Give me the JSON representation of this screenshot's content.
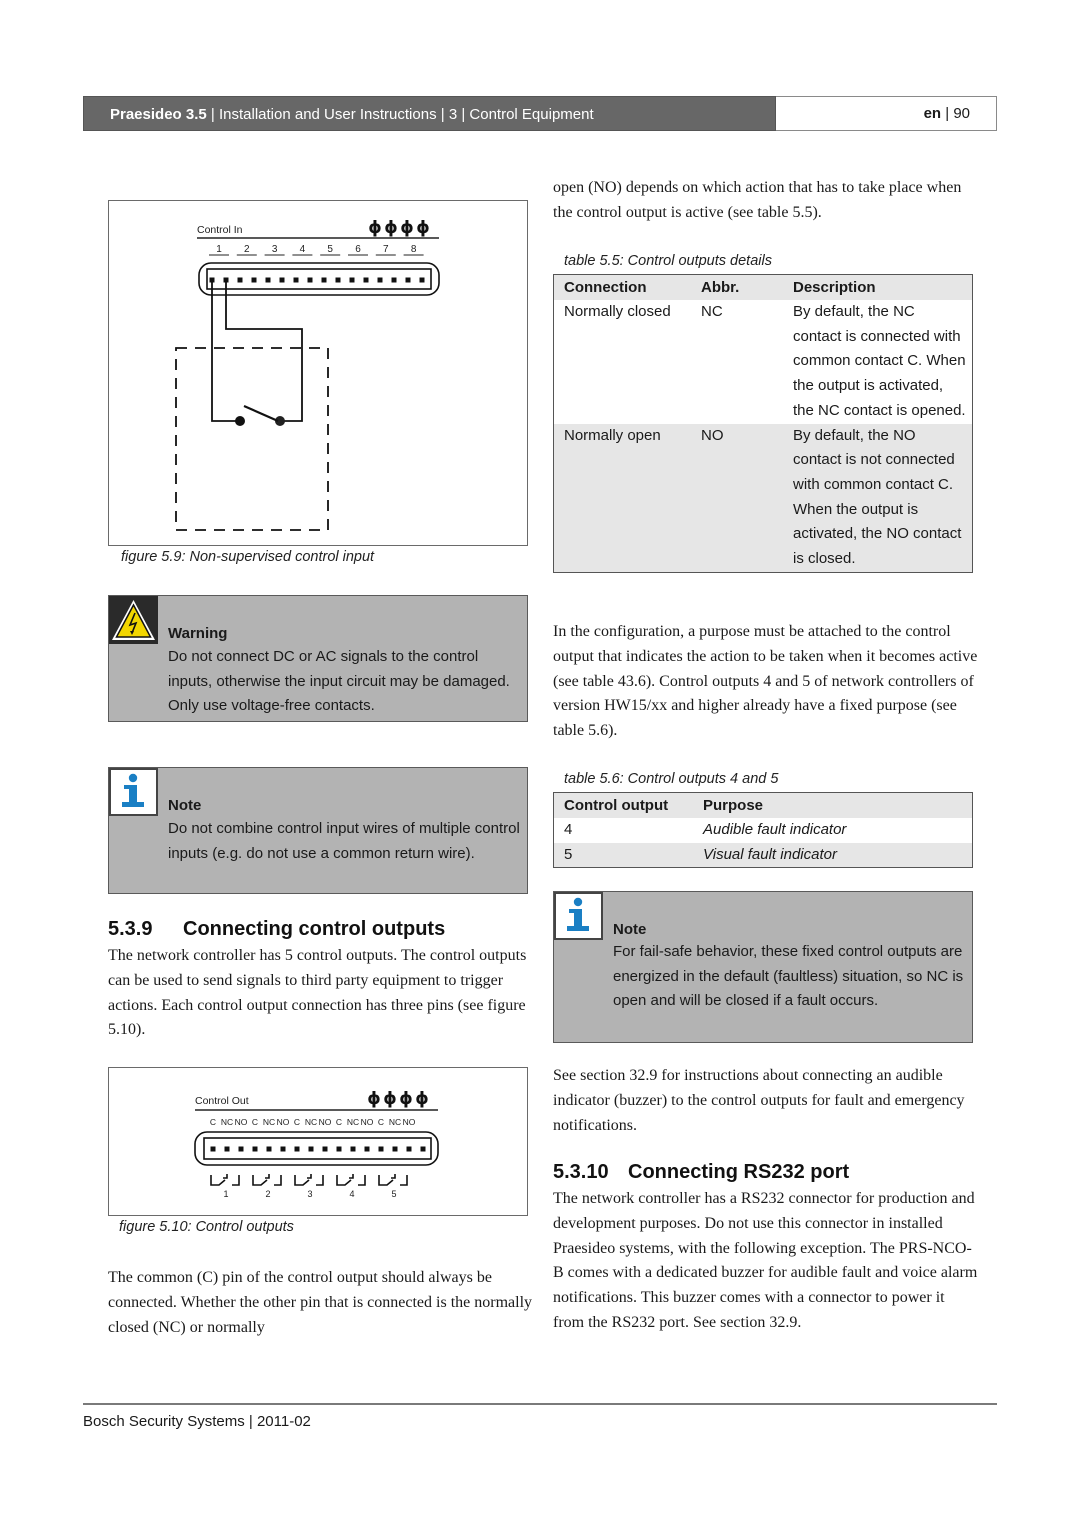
{
  "header": {
    "product": "Praesideo 3.5",
    "sep1": " | ",
    "doc_title": "Installation and User Instructions",
    "sep2": " | ",
    "chapter_num": "3",
    "sep3": " | ",
    "chapter_title": "Control Equipment",
    "lang": "en",
    "sep4": " | ",
    "page": "90"
  },
  "figure_5_9": {
    "label": "Control In",
    "pin_numbers": [
      "1",
      "2",
      "3",
      "4",
      "5",
      "6",
      "7",
      "8"
    ],
    "ground_symbols": [
      "ϕ",
      "ϕ",
      "ϕ",
      "ϕ"
    ],
    "caption": "figure 5.9: Non-supervised control input"
  },
  "warning": {
    "icon": "high-voltage-warning-icon",
    "title": "Warning",
    "text": "Do not connect DC or AC signals to the control inputs, otherwise the input circuit may be damaged. Only use voltage-free contacts."
  },
  "note1": {
    "icon": "info-icon",
    "title": "Note",
    "text": "Do not combine control input wires of multiple control inputs (e.g. do not use a common return wire)."
  },
  "section_539": {
    "number": "5.3.9",
    "title": "Connecting control outputs",
    "body": "The network controller has 5 control outputs. The control outputs can be used to send signals to third party equipment to trigger actions. Each control output connection has three pins (see figure 5.10)."
  },
  "figure_5_10": {
    "label": "Control Out",
    "pin_labels": [
      "C",
      "NC",
      "NO",
      "C",
      "NC",
      "NO",
      "C",
      "NC",
      "NO",
      "C",
      "NC",
      "NO",
      "C",
      "NC",
      "NO"
    ],
    "output_numbers": [
      "1",
      "2",
      "3",
      "4",
      "5"
    ],
    "ground_symbols": [
      "ϕ",
      "ϕ",
      "ϕ",
      "ϕ"
    ],
    "caption": "figure 5.10: Control outputs"
  },
  "para_common": "The common (C) pin of the control output should always be connected. Whether the other pin that is connected is the normally closed (NC) or normally",
  "para_open_cont": "open (NO) depends on which action that has to take place when the control output is active (see table 5.5).",
  "table_5_5": {
    "caption": "table 5.5: Control outputs details",
    "headers": [
      "Connection",
      "Abbr.",
      "Description"
    ],
    "rows": [
      [
        "Normally closed",
        "NC",
        "By default, the NC contact is connected with common contact C. When the output is activated, the NC contact is opened."
      ],
      [
        "Normally open",
        "NO",
        "By default, the NO contact is not connected with common contact C. When the output is activated, the NO contact is closed."
      ]
    ]
  },
  "para_config": "In the configuration, a purpose must be attached to the control output that indicates the action to be taken when it becomes active (see table 43.6). Control outputs 4 and 5 of network controllers of version HW15/xx and higher already have a fixed purpose (see table 5.6).",
  "table_5_6": {
    "caption": "table 5.6: Control outputs 4 and 5",
    "headers": [
      "Control output",
      "Purpose"
    ],
    "rows": [
      [
        "4",
        "Audible fault indicator"
      ],
      [
        "5",
        "Visual fault indicator"
      ]
    ]
  },
  "note2": {
    "icon": "info-icon",
    "title": "Note",
    "text": "For fail-safe behavior, these fixed control outputs are energized in the default (faultless) situation, so NC is open and will be closed if a fault occurs."
  },
  "para_see_section": "See section 32.9 for instructions about connecting an audible indicator (buzzer) to the control outputs for fault and emergency notifications.",
  "section_5310": {
    "number": "5.3.10",
    "title": "Connecting RS232 port",
    "body": "The network controller has a RS232 connector for production and development purposes. Do not use this connector in installed Praesideo systems, with the following exception. The PRS-NCO-B comes with a dedicated buzzer for audible fault and voice alarm notifications. This buzzer comes with a connector to power it from the RS232 port. See section 32.9."
  },
  "footer": {
    "company": "Bosch Security Systems",
    "sep": " | ",
    "date": "2011-02"
  },
  "colors": {
    "header_bg": "#676767",
    "callout_bg": "#b3b3b3",
    "info_blue": "#1a7fc4",
    "warning_yellow": "#f2d600",
    "table_grey": "#e6e6e6"
  }
}
